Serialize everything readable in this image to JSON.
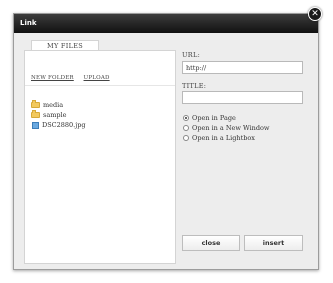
{
  "dialog": {
    "title": "Link",
    "close_glyph": "✕"
  },
  "files_panel": {
    "tab_label": "MY FILES",
    "new_folder_label": "NEW FOLDER",
    "upload_label": "UPLOAD",
    "items": [
      {
        "name": "media",
        "icon": "folder-icon"
      },
      {
        "name": "sample",
        "icon": "folder-icon"
      },
      {
        "name": "DSC2880.jpg",
        "icon": "image-icon"
      }
    ]
  },
  "form": {
    "url_label": "URL:",
    "url_value": "http://",
    "title_label": "TITLE:",
    "title_value": "",
    "open_options": [
      {
        "label": "Open in Page",
        "checked": true
      },
      {
        "label": "Open in a New Window",
        "checked": false
      },
      {
        "label": "Open in a Lightbox",
        "checked": false
      }
    ]
  },
  "buttons": {
    "close_label": "close",
    "insert_label": "insert"
  }
}
